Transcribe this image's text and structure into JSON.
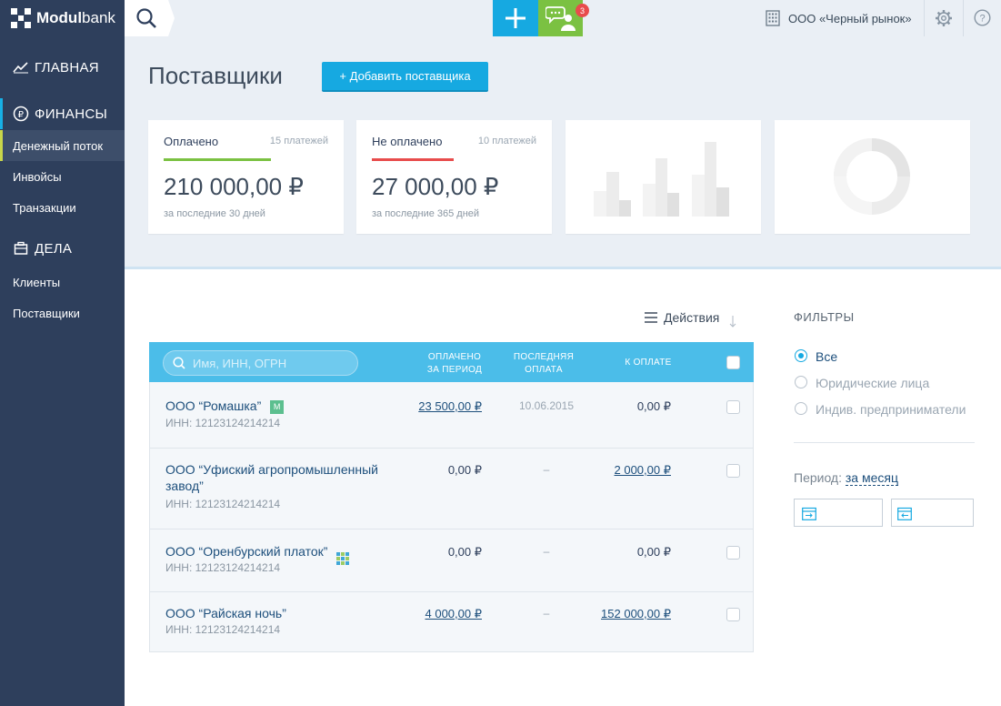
{
  "brand": {
    "logo_bold": "Modul",
    "logo_light": "bank"
  },
  "sidebar": {
    "sections": [
      {
        "label": "ГЛАВНАЯ",
        "icon": "chart-line-icon"
      },
      {
        "label": "ФИНАНСЫ",
        "icon": "ruble-circle-icon"
      },
      {
        "label": "ДЕЛА",
        "icon": "briefcase-icon"
      }
    ],
    "finance_items": [
      "Денежный поток",
      "Инвойсы",
      "Транзакции"
    ],
    "business_items": [
      "Клиенты",
      "Поставщики"
    ],
    "active_item": "Денежный поток"
  },
  "topbar": {
    "notification_count": "3",
    "company": "ООО «Черный рынок»",
    "colors": {
      "plus": "#16a9e1",
      "chat": "#7bc142"
    }
  },
  "page": {
    "title": "Поставщики",
    "add_button": "+  Добавить поставщика"
  },
  "cards": [
    {
      "label": "Оплачено",
      "count": "15 платежей",
      "sum": "210 000,00 ₽",
      "sub": "за последние 30 дней",
      "color": "#7bc142"
    },
    {
      "label": "Не оплачено",
      "count": "10 платежей",
      "sum": "27 000,00 ₽",
      "sub": "за последние 365 дней",
      "color": "#e84c4c"
    }
  ],
  "table": {
    "actions_label": "Действия",
    "search_placeholder": "Имя, ИНН, ОГРН",
    "columns": {
      "paid_line1": "ОПЛАЧЕНО",
      "paid_line2": "ЗА ПЕРИОД",
      "last_line1": "ПОСЛЕДНЯЯ",
      "last_line2": "ОПЛАТА",
      "due": "К ОПЛАТЕ"
    },
    "rows": [
      {
        "name": "ООО “Ромашка”",
        "inn": "ИНН: 12123124214214",
        "paid": "23 500,00 ₽",
        "last": "10.06.2015",
        "due": "0,00 ₽"
      },
      {
        "name": "ООО “Уфиский агропромышленный завод”",
        "inn": "ИНН: 12123124214214",
        "paid": "0,00 ₽",
        "last": "–",
        "due": "2 000,00 ₽"
      },
      {
        "name": "ООО “Оренбурский платок”",
        "inn": "ИНН: 12123124214214",
        "paid": "0,00 ₽",
        "last": "–",
        "due": "0,00 ₽"
      },
      {
        "name": "ООО “Райская ночь”",
        "inn": "ИНН: 12123124214214",
        "paid": "4 000,00 ₽",
        "last": "–",
        "due": "152 000,00 ₽"
      }
    ]
  },
  "filters": {
    "title": "ФИЛЬТРЫ",
    "options": [
      "Все",
      "Юридические лица",
      "Индив. предприниматели"
    ],
    "selected": "Все",
    "period_label": "Период:",
    "period_value": "за месяц"
  }
}
